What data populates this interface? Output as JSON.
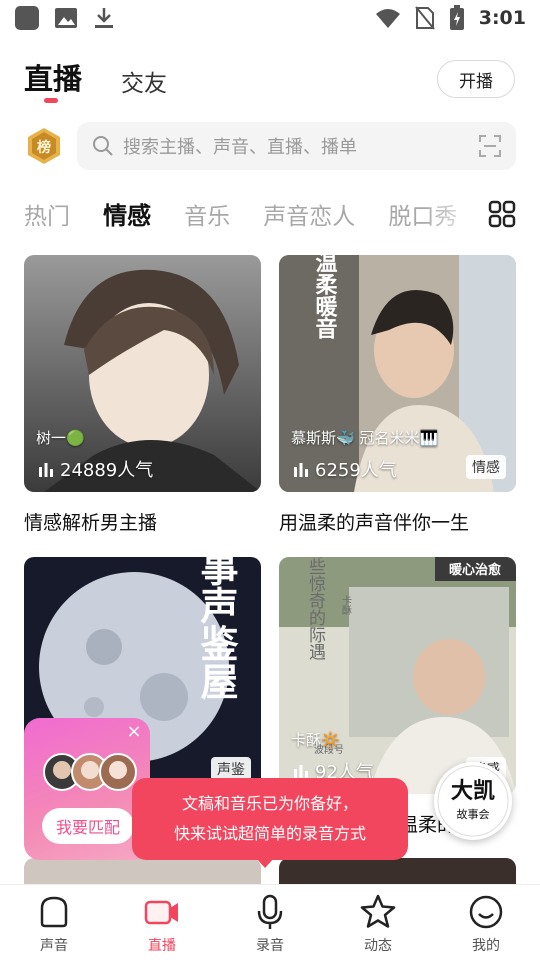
{
  "status_bar": {
    "time": "3:01"
  },
  "header": {
    "tabs": [
      {
        "label": "直播",
        "active": true
      },
      {
        "label": "交友",
        "active": false
      }
    ],
    "start_button": "开播"
  },
  "rank_badge": {
    "text": "榜"
  },
  "search": {
    "placeholder": "搜索主播、声音、直播、播单"
  },
  "categories": [
    "热门",
    "情感",
    "音乐",
    "声音恋人",
    "脱口秀"
  ],
  "active_category": "情感",
  "cards": [
    {
      "anchor": "树一🟢",
      "listeners": "24889人气",
      "tag": "",
      "title": "情感解析男主播"
    },
    {
      "anchor": "慕斯斯🐳 冠名米米🎹",
      "listeners": "6259人气",
      "tag": "情感",
      "title": "用温柔的声音伴你一生",
      "cover_text": "温柔暖音"
    },
    {
      "anchor": "",
      "listeners": "",
      "tag": "声鉴",
      "title": "",
      "cover_text": "故事声鉴屋"
    },
    {
      "anchor": "卡酥🔆",
      "listeners": "92人气",
      "tag": "情感",
      "title": "温柔的",
      "cover_text": "总有些惊奇的际遇",
      "corner_label": "暖心治愈",
      "small_text": "卡酥",
      "small_text2": "波段号"
    }
  ],
  "match_widget": {
    "button": "我要匹配"
  },
  "tooltip": {
    "line1": "文稿和音乐已为你备好，",
    "line2": "快来试试超简单的录音方式"
  },
  "fab": {
    "text_big": "大凯",
    "text_small": "故事会"
  },
  "bottom_nav": [
    {
      "label": "声音",
      "icon": "sound-icon",
      "active": false
    },
    {
      "label": "直播",
      "icon": "live-camera-icon",
      "active": true
    },
    {
      "label": "录音",
      "icon": "microphone-icon",
      "active": false
    },
    {
      "label": "动态",
      "icon": "star-icon",
      "active": false
    },
    {
      "label": "我的",
      "icon": "profile-icon",
      "active": false
    }
  ],
  "colors": {
    "accent": "#f2455e",
    "inactive_category": "#a8a8a8"
  }
}
